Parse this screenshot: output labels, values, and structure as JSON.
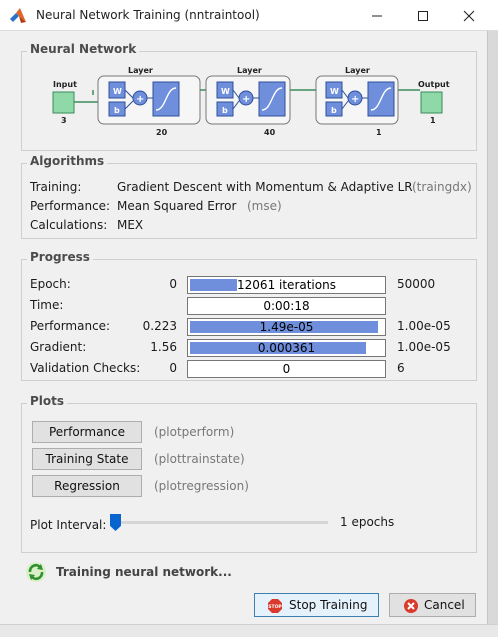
{
  "window": {
    "title": "Neural Network Training (nntraintool)"
  },
  "network": {
    "group_title": "Neural Network",
    "input_label": "Input",
    "input_size": "3",
    "output_label": "Output",
    "output_size": "1",
    "layer_title": "Layer",
    "weight_label": "W",
    "bias_label": "b",
    "sum_symbol": "+",
    "layers": [
      {
        "title": "Layer",
        "size": "20"
      },
      {
        "title": "Layer",
        "size": "40"
      },
      {
        "title": "Layer",
        "size": "1"
      }
    ]
  },
  "algorithms": {
    "group_title": "Algorithms",
    "rows": [
      {
        "label": "Training:",
        "value": "Gradient Descent with Momentum & Adaptive LR",
        "code": "(traingdx)"
      },
      {
        "label": "Performance:",
        "value": "Mean Squared Error",
        "code": "(mse)"
      },
      {
        "label": "Calculations:",
        "value": "MEX",
        "code": ""
      }
    ]
  },
  "progress": {
    "group_title": "Progress",
    "rows": [
      {
        "label": "Epoch:",
        "start": "0",
        "bar_text": "12061 iterations",
        "end": "50000",
        "fraction": 0.241
      },
      {
        "label": "Time:",
        "start": "",
        "bar_text": "0:00:18",
        "end": "",
        "fraction": 0
      },
      {
        "label": "Performance:",
        "start": "0.223",
        "bar_text": "1.49e-05",
        "end": "1.00e-05",
        "fraction": 0.975
      },
      {
        "label": "Gradient:",
        "start": "1.56",
        "bar_text": "0.000361",
        "end": "1.00e-05",
        "fraction": 0.91
      },
      {
        "label": "Validation Checks:",
        "start": "0",
        "bar_text": "0",
        "end": "6",
        "fraction": 0
      }
    ]
  },
  "plots": {
    "group_title": "Plots",
    "buttons": [
      {
        "label": "Performance",
        "fn": "(plotperform)"
      },
      {
        "label": "Training State",
        "fn": "(plottrainstate)"
      },
      {
        "label": "Regression",
        "fn": "(plotregression)"
      }
    ],
    "interval_label": "Plot Interval:",
    "interval_value": "1 epochs",
    "interval_fraction": 0.0
  },
  "status": {
    "text": "Training neural network..."
  },
  "actions": {
    "stop_label": "Stop Training",
    "cancel_label": "Cancel"
  },
  "colors": {
    "bar_fill": "#6f8fdc",
    "node_green": "#8fd9a8",
    "layer_blue": "#6f8fdc"
  }
}
